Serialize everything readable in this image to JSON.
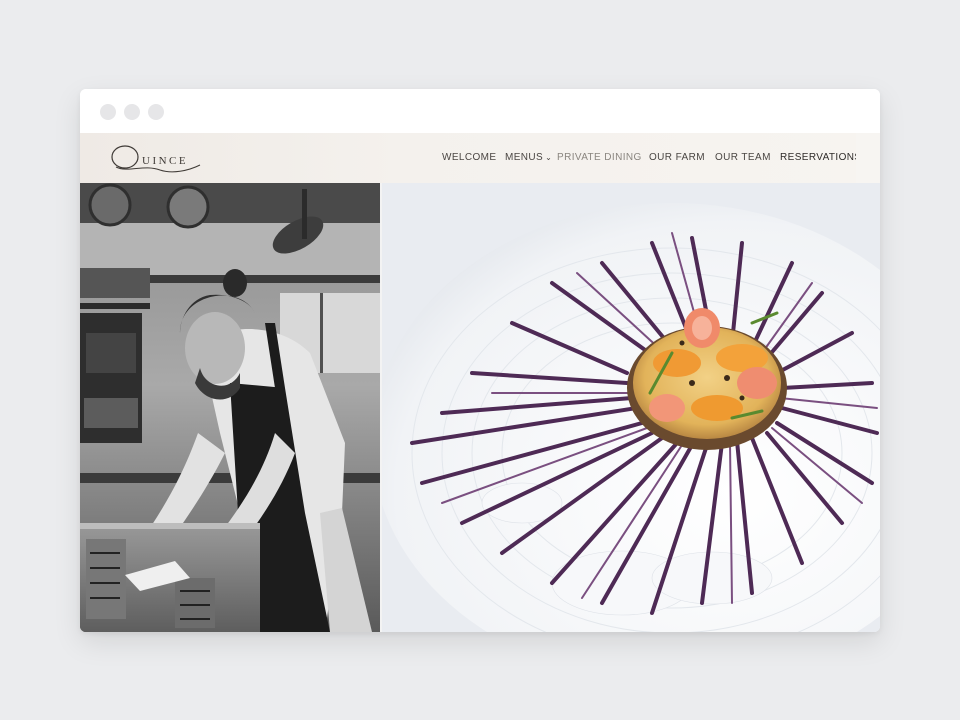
{
  "browser": {
    "window_controls": [
      "close",
      "minimize",
      "maximize"
    ]
  },
  "site": {
    "logo_text": "UINCE",
    "nav": {
      "welcome": "WELCOME",
      "menus": "MENUS",
      "private_dining": "PRIVATE DINING",
      "our_farm": "OUR FARM",
      "our_team": "OUR TEAM",
      "reservations": "RESERVATIONS"
    }
  },
  "hero": {
    "left_photo": "chef-plating-in-kitchen",
    "right_photo": "sea-urchin-dish-on-plate"
  },
  "colors": {
    "page_background": "#ebecee",
    "header_background": "#f4f1ed",
    "nav_text": "#4a4643",
    "urchin_spines": "#4e2a55",
    "dish_filling": "#e9c06a"
  }
}
